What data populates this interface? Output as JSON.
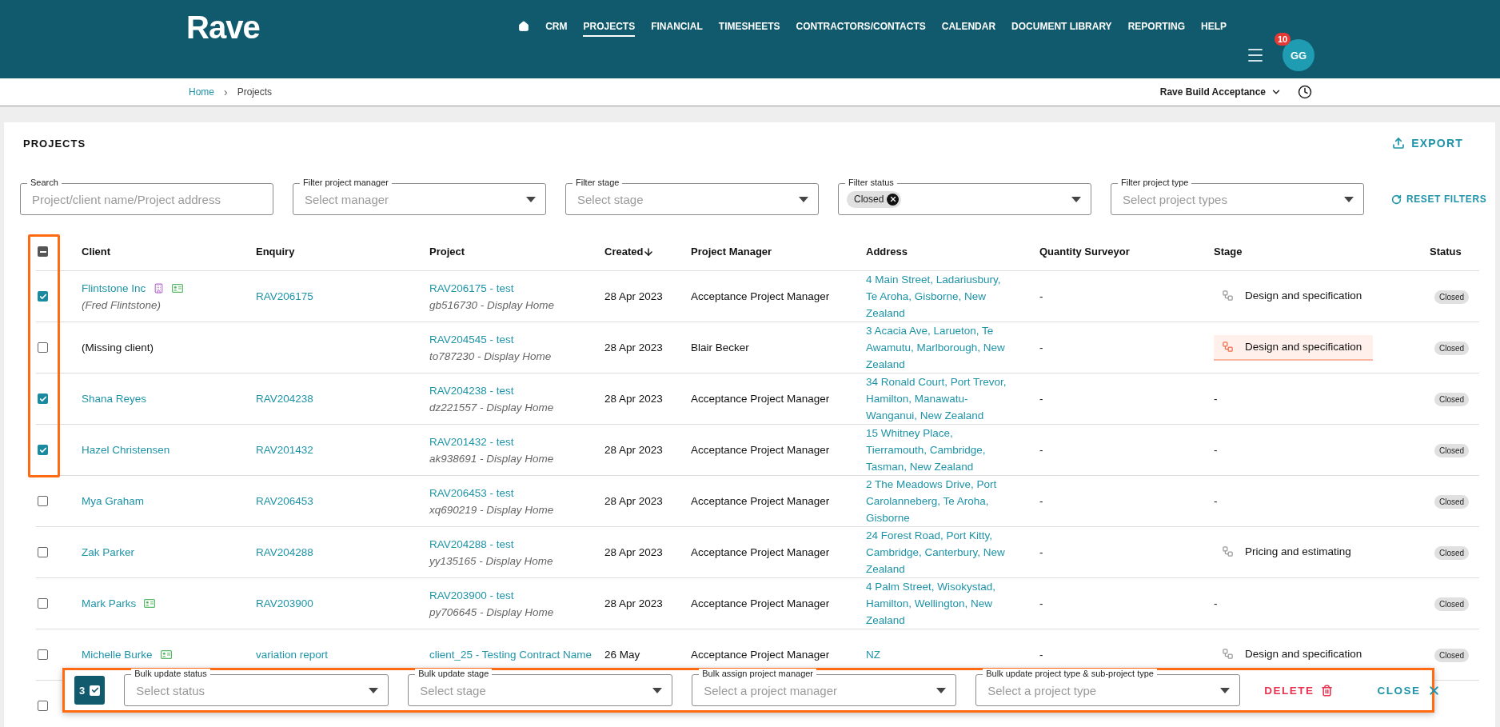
{
  "header": {
    "logo": "Rave",
    "nav": [
      {
        "label": "CRM",
        "selected": false
      },
      {
        "label": "PROJECTS",
        "selected": true
      },
      {
        "label": "FINANCIAL",
        "selected": false
      },
      {
        "label": "TIMESHEETS",
        "selected": false
      },
      {
        "label": "CONTRACTORS/CONTACTS",
        "selected": false
      },
      {
        "label": "CALENDAR",
        "selected": false
      },
      {
        "label": "DOCUMENT LIBRARY",
        "selected": false
      },
      {
        "label": "REPORTING",
        "selected": false
      },
      {
        "label": "HELP",
        "selected": false
      }
    ],
    "notification_count": "10",
    "avatar": "GG"
  },
  "breadcrumbs": [
    {
      "label": "Home",
      "link": true
    },
    {
      "label": "Projects",
      "link": false
    }
  ],
  "breadcrumb_separator": "›",
  "workspace": "Rave Build Acceptance",
  "page_title": "PROJECTS",
  "export_label": "EXPORT",
  "filters": [
    {
      "label": "Search",
      "placeholder": "Project/client name/Project address",
      "kind": "text"
    },
    {
      "label": "Filter project manager",
      "placeholder": "Select manager",
      "kind": "select"
    },
    {
      "label": "Filter stage",
      "placeholder": "Select stage",
      "kind": "select"
    },
    {
      "label": "Filter status",
      "kind": "select",
      "chips": [
        "Closed"
      ]
    },
    {
      "label": "Filter project type",
      "placeholder": "Select project types",
      "kind": "select"
    }
  ],
  "reset_label": "RESET FILTERS",
  "table": {
    "select_all_checked": true,
    "select_all_indeterminate": true,
    "columns": [
      {
        "label": "Client",
        "sorted": false
      },
      {
        "label": "Enquiry",
        "sorted": false
      },
      {
        "label": "Project",
        "sorted": false
      },
      {
        "label": "Created",
        "sorted": true
      },
      {
        "label": "Project Manager",
        "sorted": false
      },
      {
        "label": "Address",
        "sorted": false
      },
      {
        "label": "Quantity Surveyor",
        "sorted": false
      },
      {
        "label": "Stage",
        "sorted": false
      },
      {
        "label": "Status",
        "sorted": false
      }
    ],
    "rows": [
      {
        "checked": true,
        "client": {
          "name": "Flintstone Inc",
          "linked": true,
          "contact": "(Fred Flintstone)",
          "building_icon": true,
          "card_icon": true
        },
        "enquiry": "RAV206175",
        "project": {
          "title": "RAV206175 - test",
          "subtitle": "gb516730 - Display Home"
        },
        "created": "28 Apr 2023",
        "manager": "Acceptance Project Manager",
        "address": "4 Main Street, Ladariusbury, Te Aroha, Gisborne, New Zealand",
        "surveyor": "-",
        "stage": {
          "label": "Design and specification",
          "highlighted": false
        },
        "status": "Closed"
      },
      {
        "checked": false,
        "client": {
          "name": "(Missing client)",
          "linked": false
        },
        "project": {
          "title": "RAV204545 - test",
          "subtitle": "to787230 - Display Home"
        },
        "created": "28 Apr 2023",
        "manager": "Blair Becker",
        "address": "3 Acacia Ave, Larueton, Te Awamutu, Marlborough, New Zealand",
        "surveyor": "-",
        "stage": {
          "label": "Design and specification",
          "highlighted": true
        },
        "status": "Closed"
      },
      {
        "checked": true,
        "client": {
          "name": "Shana Reyes",
          "linked": true
        },
        "enquiry": "RAV204238",
        "project": {
          "title": "RAV204238 - test",
          "subtitle": "dz221557 - Display Home"
        },
        "created": "28 Apr 2023",
        "manager": "Acceptance Project Manager",
        "address": "34 Ronald Court, Port Trevor, Hamilton, Manawatu-Wanganui, New Zealand",
        "surveyor": "-",
        "stage_text": "-",
        "status": "Closed"
      },
      {
        "checked": true,
        "client": {
          "name": "Hazel Christensen",
          "linked": true
        },
        "enquiry": "RAV201432",
        "project": {
          "title": "RAV201432 - test",
          "subtitle": "ak938691 - Display Home"
        },
        "created": "28 Apr 2023",
        "manager": "Acceptance Project Manager",
        "address": "15 Whitney Place, Tierramouth, Cambridge, Tasman, New Zealand",
        "surveyor": "-",
        "stage_text": "-",
        "status": "Closed"
      },
      {
        "checked": false,
        "client": {
          "name": "Mya Graham",
          "linked": true
        },
        "enquiry": "RAV206453",
        "project": {
          "title": "RAV206453 - test",
          "subtitle": "xq690219 - Display Home"
        },
        "created": "28 Apr 2023",
        "manager": "Acceptance Project Manager",
        "address": "2 The Meadows Drive, Port Carolanneberg, Te Aroha, Gisborne",
        "surveyor": "-",
        "stage_text": "-",
        "status": "Closed"
      },
      {
        "checked": false,
        "client": {
          "name": "Zak Parker",
          "linked": true
        },
        "enquiry": "RAV204288",
        "project": {
          "title": "RAV204288 - test",
          "subtitle": "yy135165 - Display Home"
        },
        "created": "28 Apr 2023",
        "manager": "Acceptance Project Manager",
        "address": "24 Forest Road, Port Kitty, Cambridge, Canterbury, New Zealand",
        "surveyor": "-",
        "stage": {
          "label": "Pricing and estimating",
          "highlighted": false
        },
        "status": "Closed"
      },
      {
        "checked": false,
        "client": {
          "name": "Mark Parks",
          "linked": true,
          "card_icon": true
        },
        "enquiry": "RAV203900",
        "project": {
          "title": "RAV203900 - test",
          "subtitle": "py706645 - Display Home"
        },
        "created": "28 Apr 2023",
        "manager": "Acceptance Project Manager",
        "address": "4 Palm Street, Wisokystad, Hamilton, Wellington, New Zealand",
        "surveyor": "-",
        "stage_text": "-",
        "status": "Closed"
      },
      {
        "checked": false,
        "client": {
          "name": "Michelle Burke",
          "linked": true,
          "card_icon": true
        },
        "enquiry": "variation report",
        "project": {
          "title": "client_25 - Testing Contract Name"
        },
        "created": "26 May",
        "manager": "Acceptance Project Manager",
        "address": "NZ",
        "surveyor": "-",
        "stage": {
          "label": "Design and specification",
          "highlighted": false
        },
        "status": "Closed"
      },
      {
        "checked": false
      }
    ]
  },
  "bulk_bar": {
    "count": "3",
    "fields": [
      {
        "label": "Bulk update status",
        "placeholder": "Select status"
      },
      {
        "label": "Bulk update stage",
        "placeholder": "Select stage"
      },
      {
        "label": "Bulk assign project manager",
        "placeholder": "Select a project manager"
      },
      {
        "label": "Bulk update project type & sub-project type",
        "placeholder": "Select a project type"
      }
    ],
    "delete_label": "DELETE",
    "close_label": "CLOSE"
  }
}
